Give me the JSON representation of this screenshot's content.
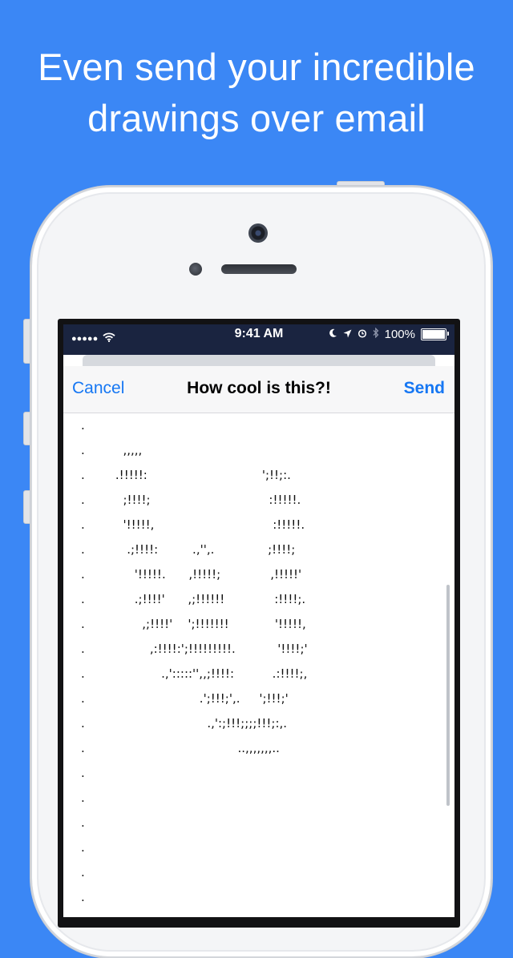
{
  "headline": {
    "line1": "Even send your incredible",
    "line2": "drawings over email"
  },
  "status_bar": {
    "signal": "●●●●●",
    "time": "9:41 AM",
    "battery": "100%"
  },
  "compose": {
    "cancel_label": "Cancel",
    "title": "How cool is this?!",
    "send_label": "Send",
    "body_art": [
      ".",
      ".          ,,,,,",
      ".        .!!!!!:                              ';!!;:.",
      ".          ;!!!!;                               :!!!!!.",
      ".          '!!!!!,                               :!!!!!.",
      ".           .;!!!!:         .,'',.              ;!!!!;",
      ".             '!!!!!.      ,!!!!!;             ,!!!!!'",
      ".             .;!!!!'      ,;!!!!!!             :!!!!;.",
      ".               ,;!!!!'    ';!!!!!!!            '!!!!!,",
      ".                 ,:!!!!:';!!!!!!!!!.           '!!!!;'",
      ".                    .,':::::'',,;!!!!:          .:!!!!;,",
      ".                              .';!!!;',.     ';!!!;'",
      ".                                .,':;!!!;;;;!!!;:,.",
      ".                                        ..,,,,,,,..",
      ".",
      ".",
      ".",
      ".",
      ".",
      "."
    ]
  },
  "colors": {
    "background": "#3b87f5",
    "accent": "#1677f3",
    "status_bar": "#1a2440"
  }
}
